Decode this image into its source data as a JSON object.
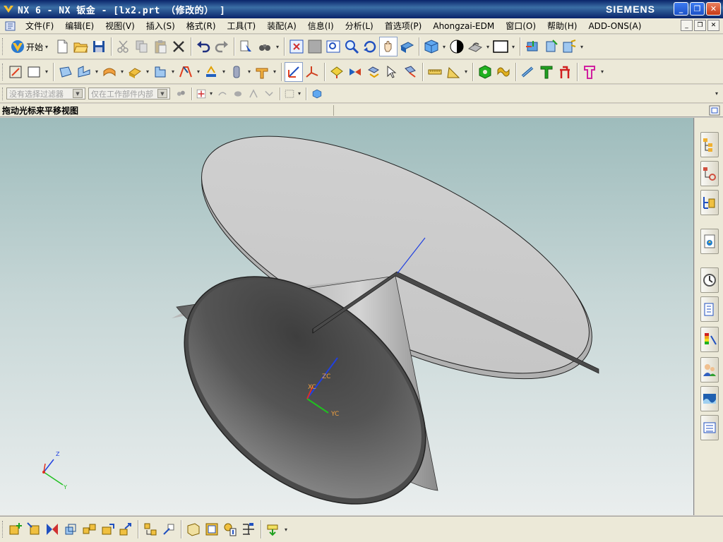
{
  "window": {
    "title": "NX 6 - NX 钣金 - [lx2.prt （修改的） ]",
    "brand": "SIEMENS",
    "minimize": "_",
    "restore": "❐",
    "close": "✕"
  },
  "menubar": {
    "items": [
      "文件(F)",
      "编辑(E)",
      "视图(V)",
      "插入(S)",
      "格式(R)",
      "工具(T)",
      "装配(A)",
      "信息(I)",
      "分析(L)",
      "首选项(P)",
      "Ahongzai-EDM",
      "窗口(O)",
      "帮助(H)",
      "ADD-ONS(A)"
    ]
  },
  "toolbar_standard": {
    "start_label": "开始"
  },
  "selection_bar": {
    "type_filter_placeholder": "没有选择过滤器",
    "scope_placeholder": "仅在工作部件内部"
  },
  "cue_line": {
    "text": "拖动光标来平移视图"
  },
  "viewport": {
    "wcs_labels": {
      "x": "XC",
      "y": "YC",
      "z": "ZC"
    },
    "triad_labels": {
      "y": "Y",
      "z": "Z"
    },
    "colors": {
      "background_top": "#9ebcbc",
      "background_bottom": "#eaeeee",
      "part_face": "#c8c8c8",
      "part_shadow": "#5a5a5a",
      "axis_x": "#e03020",
      "axis_y": "#20c020",
      "axis_z": "#2040e0"
    }
  },
  "icons": {
    "toolbar_row1": [
      "new-icon",
      "open-icon",
      "save-icon",
      "cut-icon",
      "copy-icon",
      "paste-icon",
      "delete-icon",
      "undo-icon",
      "redo-icon",
      "info-icon",
      "binoculars-icon",
      "fit-icon",
      "zoom-window-icon",
      "zoom-icon",
      "rotate-icon",
      "pan-icon",
      "view-orient-icon",
      "shaded-icon",
      "wireframe-icon",
      "display-icon",
      "background-icon",
      "view-triad-icon",
      "tool-a-icon",
      "tool-b-icon"
    ],
    "toolbar_row2": [
      "sketch-icon",
      "rect-icon",
      "tab-icon",
      "flange-icon",
      "contour-icon",
      "bend-icon",
      "corner-icon",
      "jog-icon",
      "unbend-icon",
      "tube-icon",
      "cut-icon",
      "datum-icon",
      "csys-icon",
      "paint-icon",
      "analysis-icon",
      "measure-icon",
      "angle-icon",
      "hex-icon",
      "bolt-icon",
      "pin-icon",
      "t-icon",
      "gear-icon",
      "clamp-icon"
    ],
    "right_resource_bar": [
      "assembly-navigator-icon",
      "constraint-navigator-icon",
      "part-navigator-icon",
      "reuse-library-icon",
      "history-icon",
      "system-materials-icon",
      "palette-icon",
      "roles-icon",
      "system-scenes-icon",
      "simulation-icon"
    ],
    "bottom_toolbar": [
      "add-component-icon",
      "move-component-icon",
      "mate-icon",
      "reposition-icon",
      "explode-icon",
      "wave-icon",
      "sequence-icon",
      "clone-icon",
      "replace-icon",
      "assembly-cut-icon",
      "reference-set-icon",
      "properties-icon",
      "where-used-icon",
      "tree-icon"
    ]
  }
}
